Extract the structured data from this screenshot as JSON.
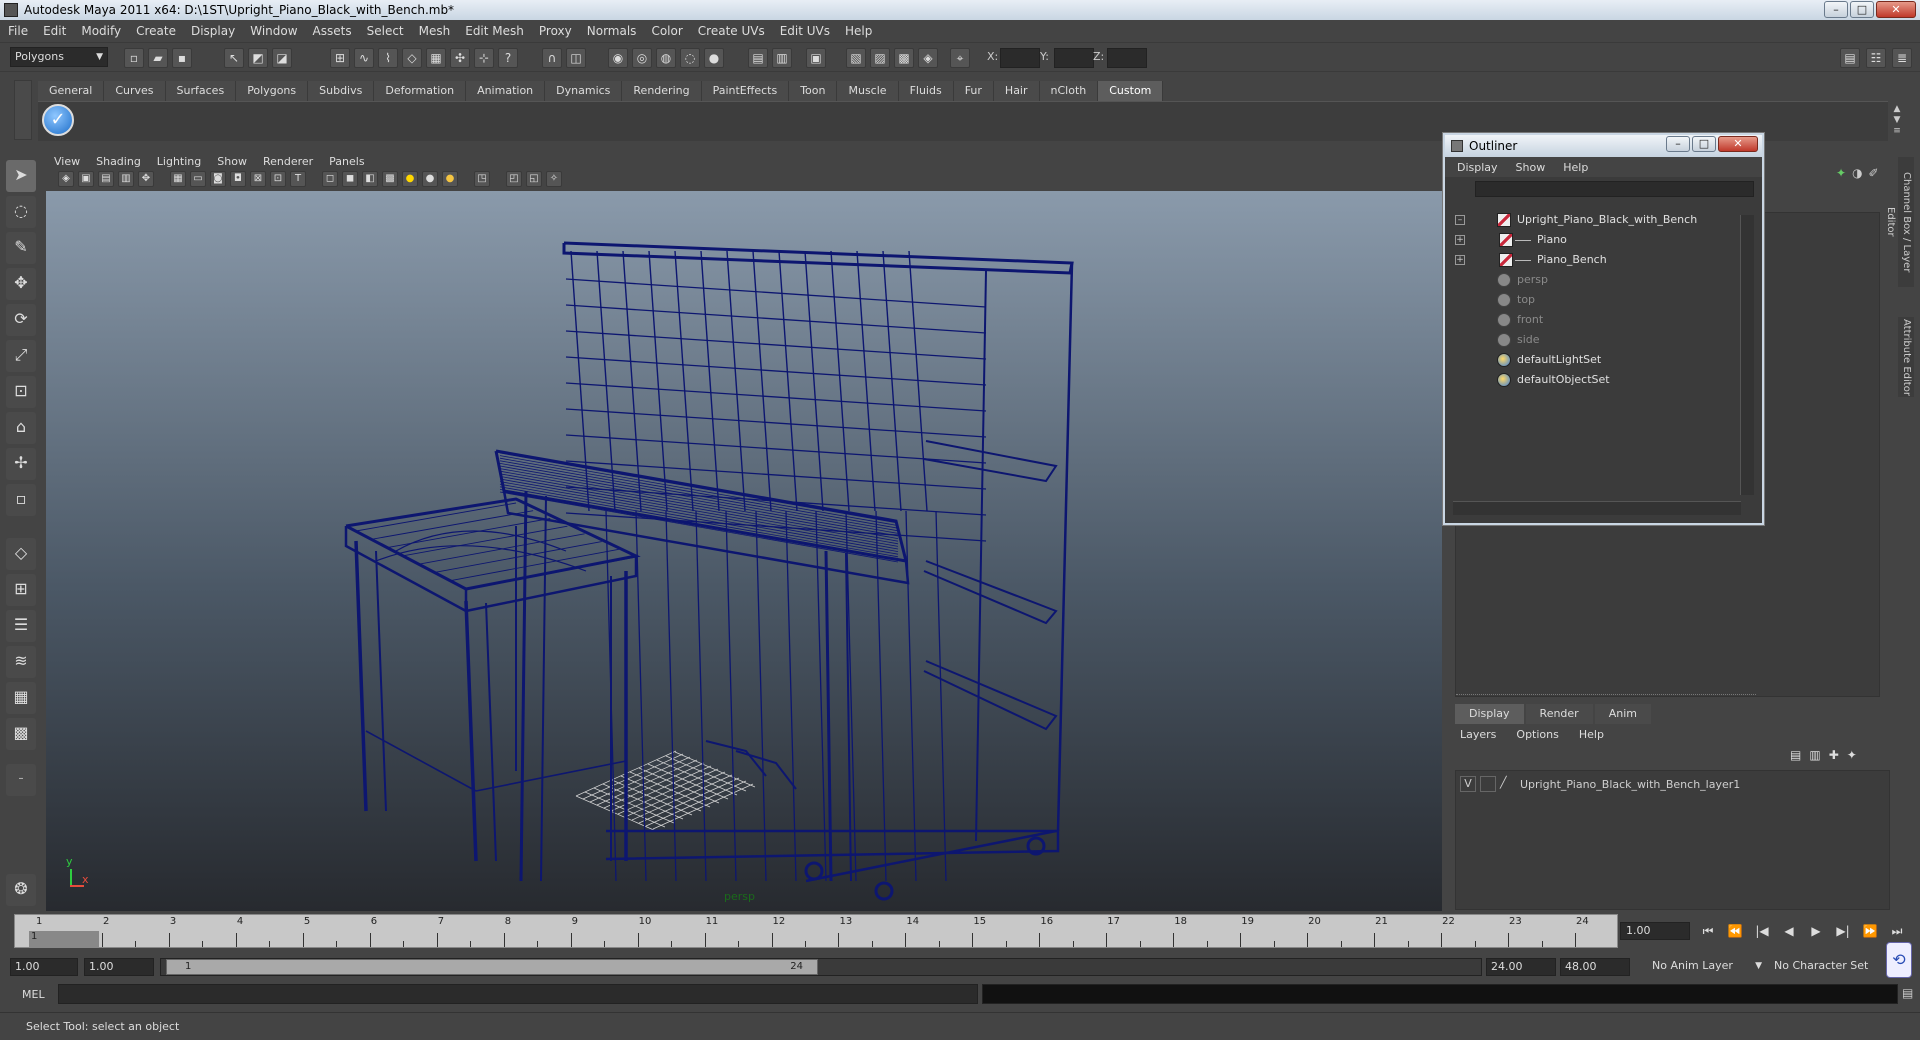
{
  "window": {
    "title": "Autodesk Maya 2011 x64: D:\\1ST\\Upright_Piano_Black_with_Bench.mb*",
    "minimize": "–",
    "maximize": "□",
    "close": "✕"
  },
  "menubar": [
    "File",
    "Edit",
    "Modify",
    "Create",
    "Display",
    "Window",
    "Assets",
    "Select",
    "Mesh",
    "Edit Mesh",
    "Proxy",
    "Normals",
    "Color",
    "Create UVs",
    "Edit UVs",
    "Help"
  ],
  "statusline": {
    "mode": "Polygons",
    "x_label": "X:",
    "y_label": "Y:",
    "z_label": "Z:"
  },
  "shelf": {
    "tabs": [
      "General",
      "Curves",
      "Surfaces",
      "Polygons",
      "Subdivs",
      "Deformation",
      "Animation",
      "Dynamics",
      "Rendering",
      "PaintEffects",
      "Toon",
      "Muscle",
      "Fluids",
      "Fur",
      "Hair",
      "nCloth",
      "Custom"
    ],
    "active_tab": "Custom"
  },
  "viewport": {
    "menu": [
      "View",
      "Shading",
      "Lighting",
      "Show",
      "Renderer",
      "Panels"
    ],
    "camera_label": "persp",
    "axis_y": "y",
    "axis_x": "x",
    "wire_color": "#0d1670"
  },
  "outliner": {
    "title": "Outliner",
    "menu": [
      "Display",
      "Show",
      "Help"
    ],
    "items": [
      {
        "label": "Upright_Piano_Black_with_Bench",
        "icon": "mesh-icon",
        "expand": "–",
        "dim": false,
        "indent": 0
      },
      {
        "label": "Piano",
        "icon": "mesh-icon",
        "expand": "+",
        "dim": false,
        "indent": 1
      },
      {
        "label": "Piano_Bench",
        "icon": "mesh-icon",
        "expand": "+",
        "dim": false,
        "indent": 1
      },
      {
        "label": "persp",
        "icon": "camera-icon",
        "expand": "",
        "dim": true,
        "indent": 0
      },
      {
        "label": "top",
        "icon": "camera-icon",
        "expand": "",
        "dim": true,
        "indent": 0
      },
      {
        "label": "front",
        "icon": "camera-icon",
        "expand": "",
        "dim": true,
        "indent": 0
      },
      {
        "label": "side",
        "icon": "camera-icon",
        "expand": "",
        "dim": true,
        "indent": 0
      },
      {
        "label": "defaultLightSet",
        "icon": "set-icon",
        "expand": "",
        "dim": false,
        "indent": 0
      },
      {
        "label": "defaultObjectSet",
        "icon": "set-icon",
        "expand": "",
        "dim": false,
        "indent": 0
      }
    ]
  },
  "side_tabs": [
    "Channel Box / Layer Editor",
    "Attribute Editor"
  ],
  "layer_editor": {
    "tabs": [
      "Display",
      "Render",
      "Anim"
    ],
    "active_tab": "Display",
    "menu": [
      "Layers",
      "Options",
      "Help"
    ],
    "layer": {
      "visible": "V",
      "name": "Upright_Piano_Black_with_Bench_layer1"
    }
  },
  "timeline": {
    "start_frame": "1",
    "frames": [
      "1",
      "2",
      "3",
      "4",
      "5",
      "6",
      "7",
      "8",
      "9",
      "10",
      "11",
      "12",
      "13",
      "14",
      "15",
      "16",
      "17",
      "18",
      "19",
      "20",
      "21",
      "22",
      "23",
      "24"
    ],
    "current_time": "1.00",
    "playback": [
      "⏮",
      "⏪",
      "|◀",
      "◀",
      "▶",
      "▶|",
      "⏩",
      "⏭"
    ]
  },
  "range": {
    "start": "1.00",
    "playback_start": "1.00",
    "handle_start": "1",
    "handle_end": "24",
    "playback_end": "24.00",
    "end": "48.00",
    "anim_layer": "No Anim Layer",
    "character_set": "No Character Set"
  },
  "commandline": {
    "label": "MEL"
  },
  "helpline": {
    "text": "Select Tool: select an object"
  }
}
